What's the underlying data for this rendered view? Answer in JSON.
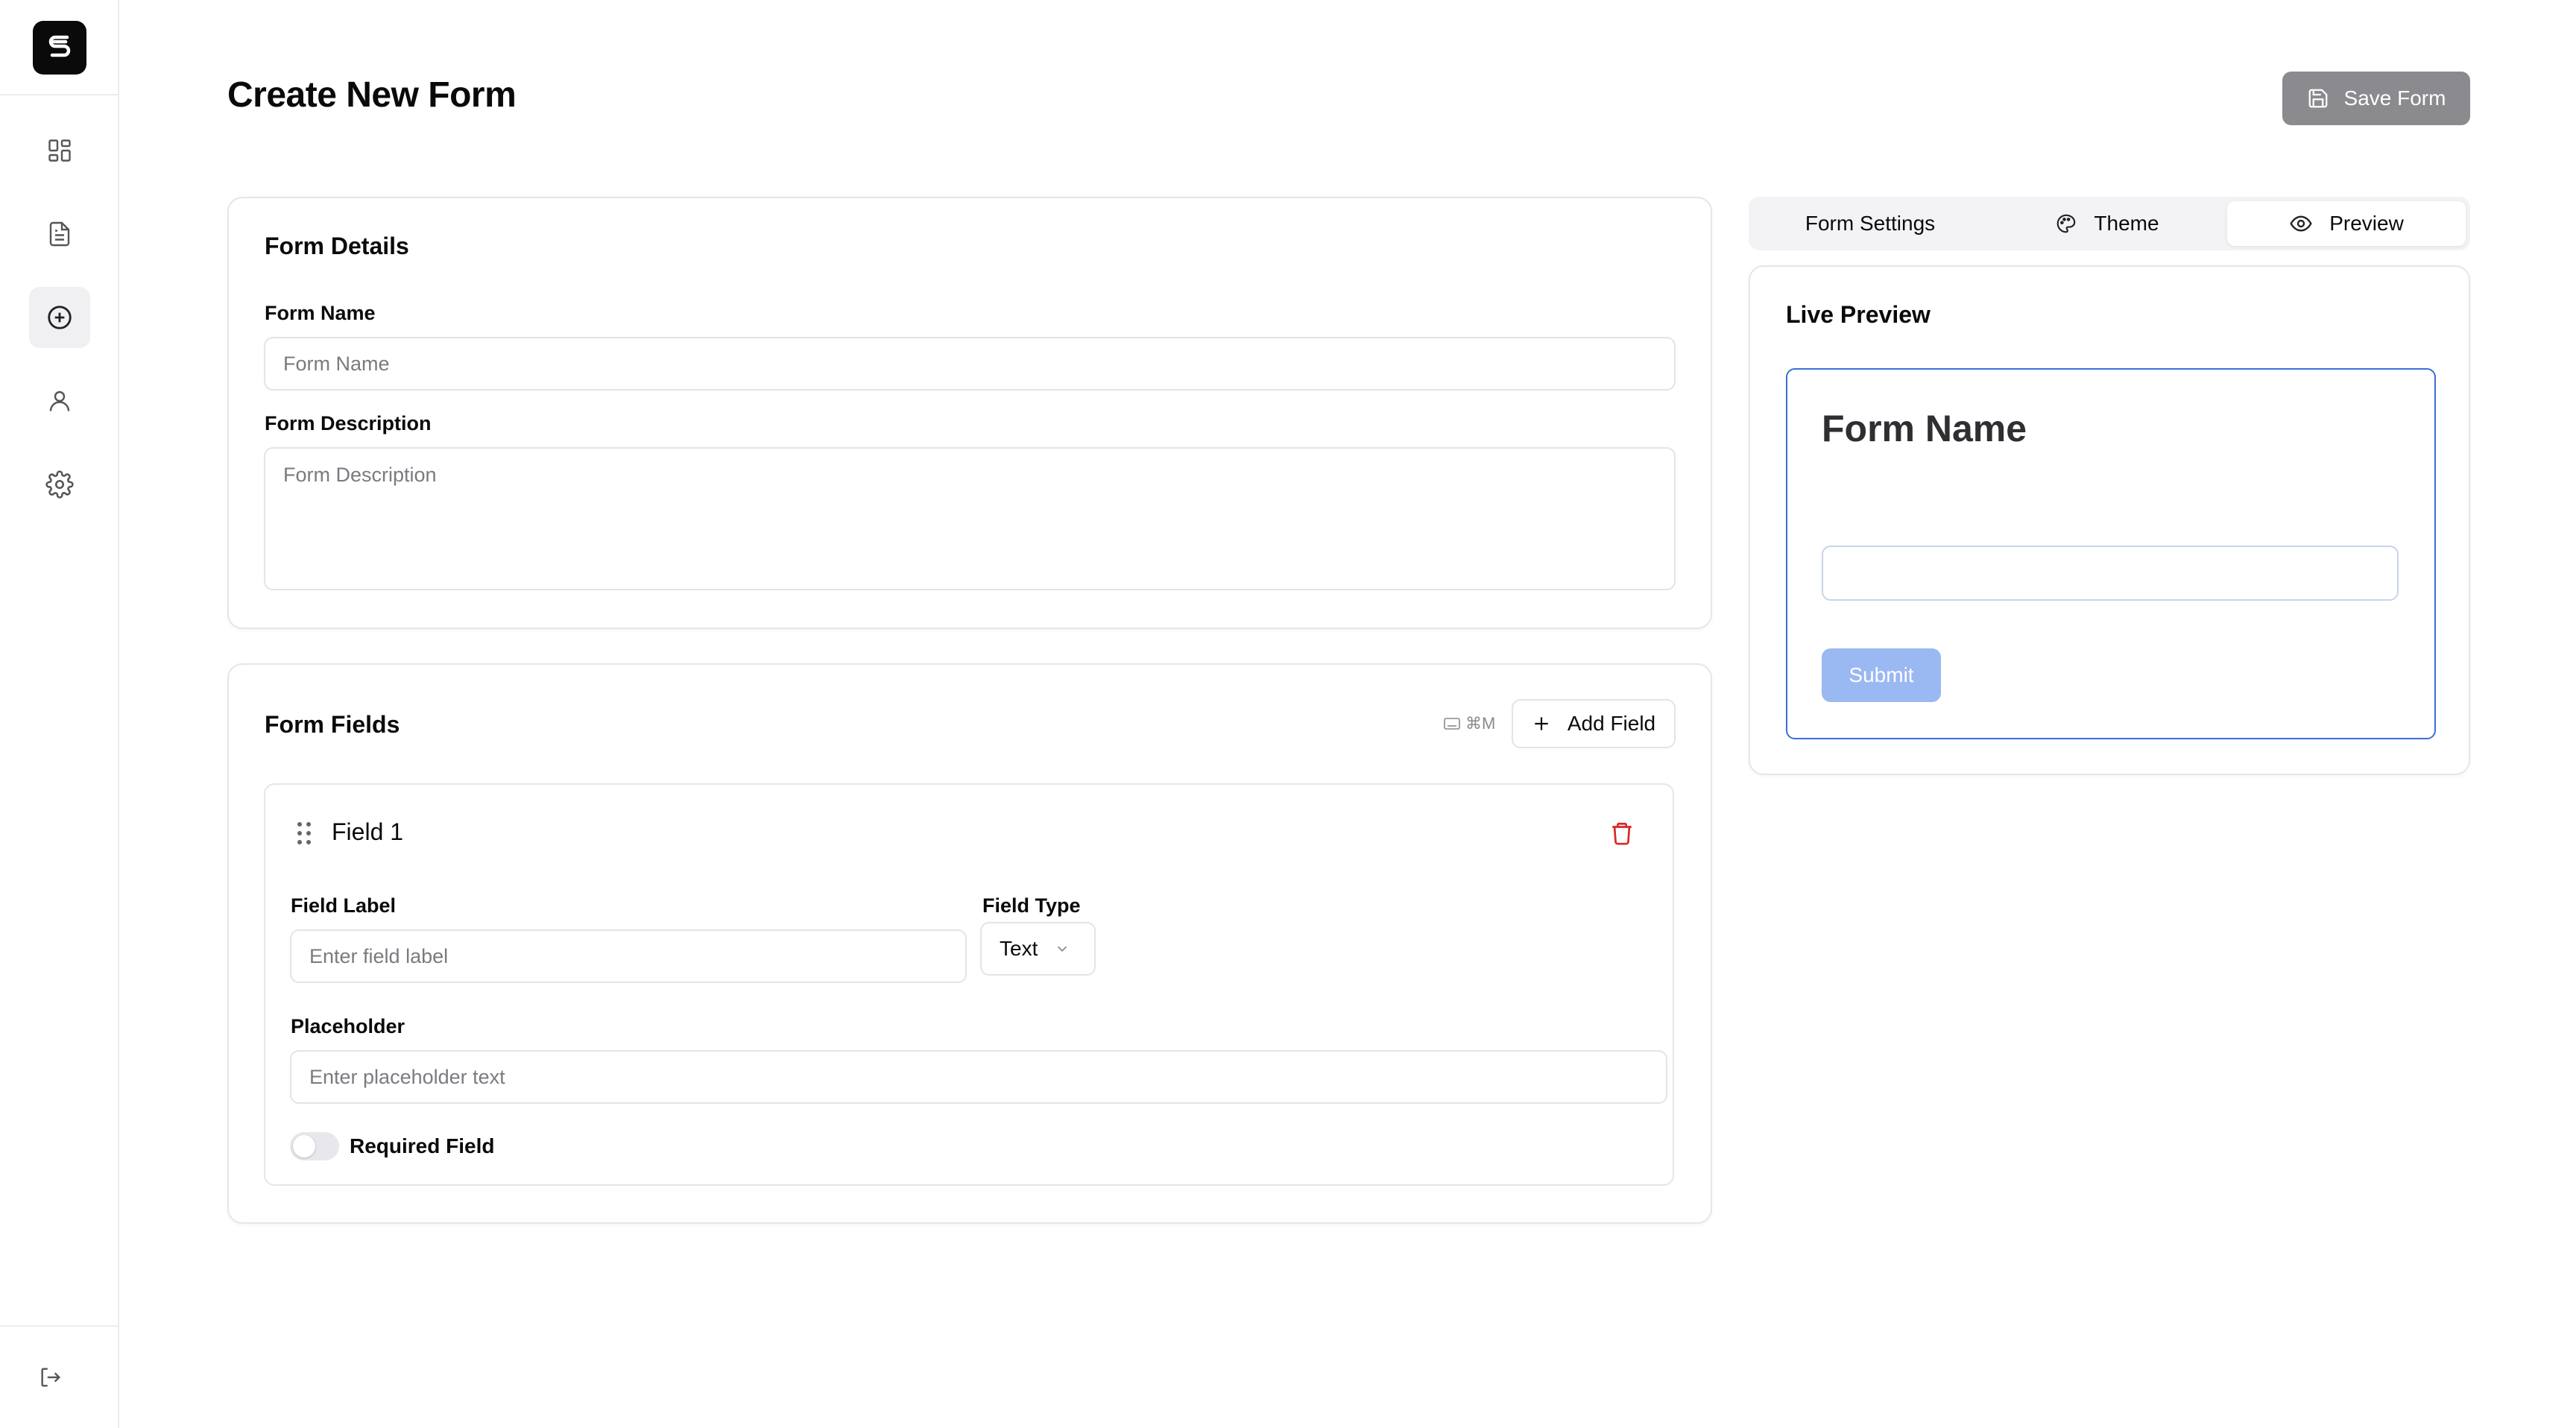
{
  "sidebar": {
    "logo_icon": "brand-logo-icon",
    "items": [
      {
        "icon": "dashboard-icon",
        "active": false
      },
      {
        "icon": "document-icon",
        "active": false
      },
      {
        "icon": "plus-circle-icon",
        "active": true
      },
      {
        "icon": "user-icon",
        "active": false
      },
      {
        "icon": "gear-icon",
        "active": false
      }
    ],
    "logout_icon": "logout-icon"
  },
  "header": {
    "title": "Create New Form",
    "save_label": "Save Form"
  },
  "form_details": {
    "title": "Form Details",
    "name_label": "Form Name",
    "name_placeholder": "Form Name",
    "description_label": "Form Description",
    "description_placeholder": "Form Description"
  },
  "form_fields": {
    "title": "Form Fields",
    "shortcut": "⌘M",
    "add_label": "Add Field",
    "fields": [
      {
        "title": "Field 1",
        "label_label": "Field Label",
        "label_placeholder": "Enter field label",
        "type_label": "Field Type",
        "type_value": "Text",
        "placeholder_label": "Placeholder",
        "placeholder_placeholder": "Enter placeholder text",
        "required_label": "Required Field",
        "required": false
      }
    ]
  },
  "tabs": [
    {
      "label": "Form Settings",
      "icon": "",
      "active": false
    },
    {
      "label": "Theme",
      "icon": "palette-icon",
      "active": false
    },
    {
      "label": "Preview",
      "icon": "eye-icon",
      "active": true
    }
  ],
  "preview": {
    "title": "Live Preview",
    "form_title": "Form Name",
    "submit_label": "Submit"
  },
  "colors": {
    "accent": "#3b6fd4",
    "submit_disabled": "#9ab8f2",
    "save_disabled": "#8a8a8f",
    "danger": "#dc2626"
  }
}
